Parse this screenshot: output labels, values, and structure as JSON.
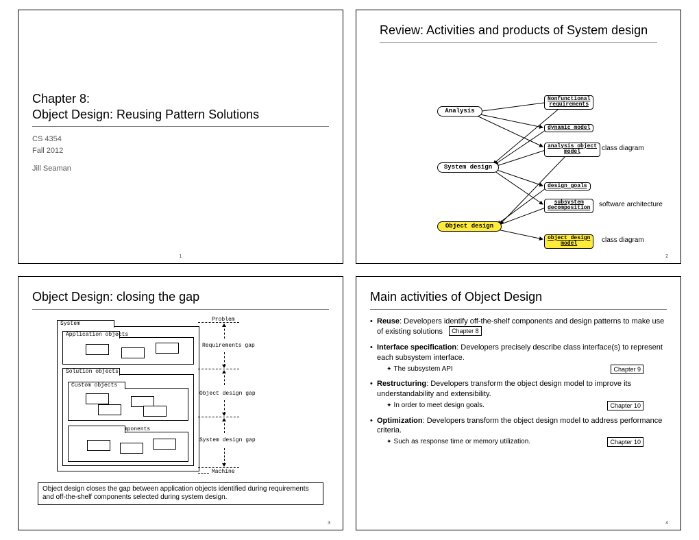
{
  "slide1": {
    "title_a": "Chapter 8:",
    "title_b": "Object Design: Reusing Pattern Solutions",
    "course": "CS 4354",
    "term": "Fall 2012",
    "instructor": "Jill Seaman",
    "page": "1"
  },
  "slide2": {
    "title": "Review: Activities and products of System design",
    "boxes": {
      "analysis": "Analysis",
      "nonfunc": "Nonfunctional\nrequirements",
      "dynamic": "dynamic model",
      "analysis_obj": "analysis object\nmodel",
      "sysdesign": "System design",
      "design_goals": "design goals",
      "subsystem": "subsystem\ndecomposition",
      "objdesign": "Object design",
      "objdesign_model": "object design\nmodel"
    },
    "labels": {
      "class_diagram_1": "class diagram",
      "software_arch": "software architecture",
      "class_diagram_2": "class diagram"
    },
    "page": "2"
  },
  "slide3": {
    "title": "Object Design: closing the gap",
    "folders": {
      "system": "System",
      "problem": "Problem",
      "app_objects": "Application objects",
      "solution_objects": "Solution objects",
      "custom_objects": "Custom objects",
      "off_shelf": "Off-the-shelf components",
      "machine": "Machine"
    },
    "gaps": {
      "req": "Requirements gap",
      "obj": "Object design gap",
      "sys": "System design gap"
    },
    "caption": "Object design closes the gap between application objects identified during requirements and off-the-shelf components selected during system design.",
    "page": "3"
  },
  "slide4": {
    "title": "Main activities of Object Design",
    "items": {
      "reuse_head": "Reuse",
      "reuse_body": ": Developers identify off-the-shelf components and design patterns to make use of existing solutions",
      "reuse_ch": "Chapter 8",
      "ifspec_head": "Interface specification",
      "ifspec_body": ": Developers precisely describe class interface(s) to represent each subsystem interface.",
      "ifspec_sub": "The subsystem API",
      "ifspec_ch": "Chapter 9",
      "restruct_head": "Restructuring",
      "restruct_body": ": Developers transform the object design model to improve its understandability and extensibility.",
      "restruct_sub": "In order to meet design goals.",
      "restruct_ch": "Chapter 10",
      "opt_head": "Optimization",
      "opt_body": ": Developers transform the object design model to address performance criteria.",
      "opt_sub": "Such as response time or memory utilization.",
      "opt_ch": "Chapter 10"
    },
    "page": "4"
  }
}
